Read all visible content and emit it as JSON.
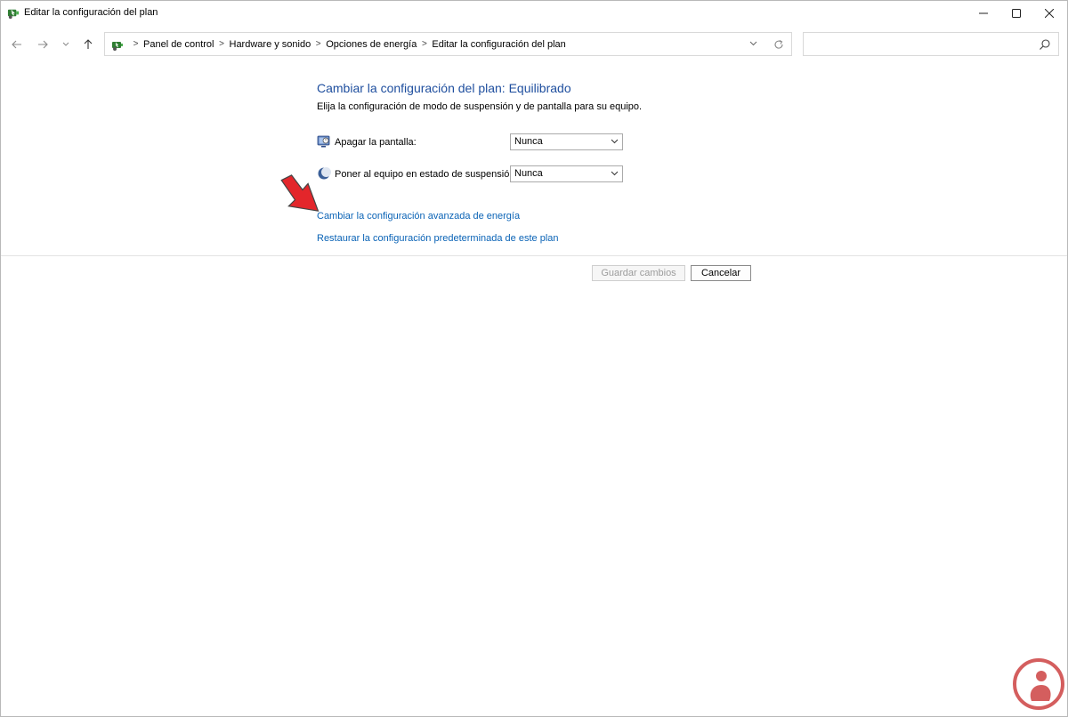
{
  "window": {
    "title": "Editar la configuración del plan",
    "controls": {
      "minimize": "minimize-icon",
      "maximize": "maximize-icon",
      "close": "close-icon"
    }
  },
  "navigation": {
    "back": "arrow-left-icon",
    "forward": "arrow-right-icon",
    "recent": "chevron-down-icon",
    "up": "arrow-up-icon"
  },
  "address": {
    "breadcrumbs": [
      "Panel de control",
      "Hardware y sonido",
      "Opciones de energía",
      "Editar la configuración del plan"
    ],
    "separator": ">"
  },
  "search": {
    "placeholder": "",
    "value": ""
  },
  "content": {
    "heading": "Cambiar la configuración del plan: Equilibrado",
    "subheading": "Elija la configuración de modo de suspensión y de pantalla para su equipo.",
    "settings": [
      {
        "label": "Apagar la pantalla:",
        "value": "Nunca",
        "icon": "monitor-icon"
      },
      {
        "label": "Poner al equipo en estado de suspensión:",
        "value": "Nunca",
        "icon": "moon-icon"
      }
    ],
    "links": [
      "Cambiar la configuración avanzada de energía",
      "Restaurar la configuración predeterminada de este plan"
    ]
  },
  "buttons": {
    "save": "Guardar cambios",
    "cancel": "Cancelar"
  },
  "colors": {
    "heading": "#1e4e9e",
    "link": "#0a63b6",
    "annotation_arrow": "#e3262b",
    "watermark": "#c62828"
  }
}
